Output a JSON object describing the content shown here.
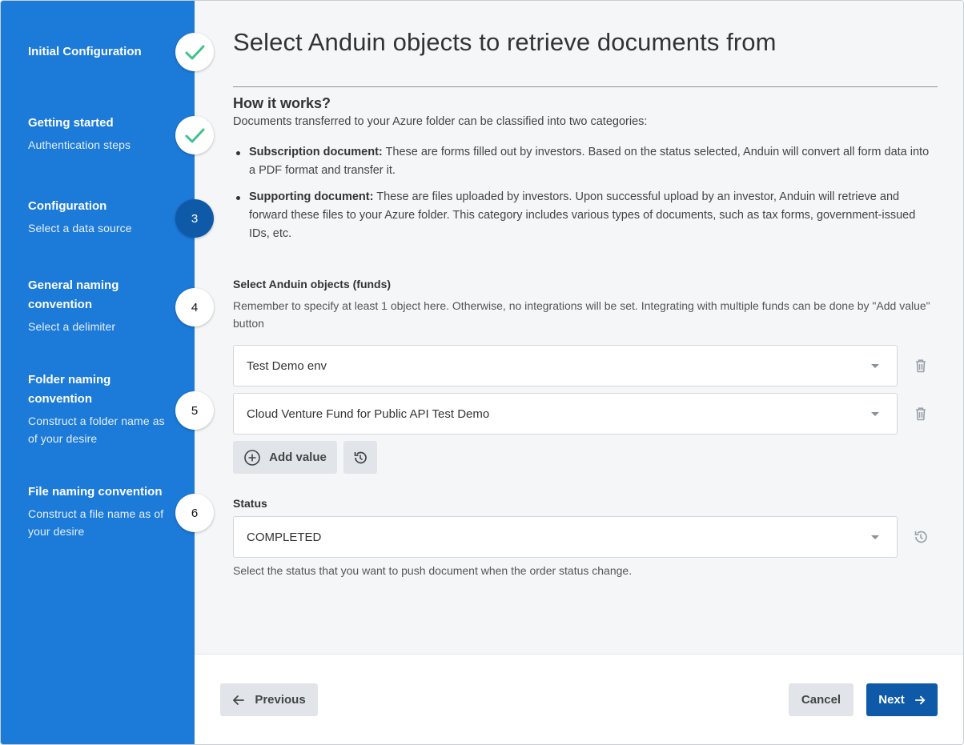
{
  "sidebar": {
    "steps": [
      {
        "title": "Initial Configuration",
        "subtitle": "",
        "marker": "check"
      },
      {
        "title": "Getting started",
        "subtitle": "Authentication steps",
        "marker": "check"
      },
      {
        "title": "Configuration",
        "subtitle": "Select a data source",
        "marker": "3"
      },
      {
        "title": "General naming convention",
        "subtitle": "Select a delimiter",
        "marker": "4"
      },
      {
        "title": "Folder naming convention",
        "subtitle": "Construct a folder name as of your desire",
        "marker": "5"
      },
      {
        "title": "File naming convention",
        "subtitle": "Construct a file name as of your desire",
        "marker": "6"
      }
    ]
  },
  "main": {
    "title": "Select Anduin objects to retrieve documents from",
    "how": {
      "title": "How it works?",
      "intro": "Documents transferred to your Azure folder can be classified into two categories:",
      "bullets": [
        {
          "term": "Subscription document:",
          "text": " These are forms filled out by investors. Based on the status selected, Anduin will convert all form data into a PDF format and transfer it."
        },
        {
          "term": "Supporting document:",
          "text": " These are files uploaded by investors. Upon successful upload by an investor, Anduin will retrieve and forward these files to your Azure folder. This category includes various types of documents, such as tax forms, government-issued IDs, etc."
        }
      ]
    },
    "objects": {
      "label": "Select Anduin objects (funds)",
      "helper": "Remember to specify at least 1 object here. Otherwise, no integrations will be set. Integrating with multiple funds can be done by \"Add value\" button",
      "values": [
        "Test Demo env",
        "Cloud Venture Fund for Public API Test Demo"
      ],
      "add_label": "Add value"
    },
    "status": {
      "label": "Status",
      "value": "COMPLETED",
      "helper": "Select the status that you want to push document when the order status change."
    }
  },
  "footer": {
    "previous_label": "Previous",
    "cancel_label": "Cancel",
    "next_label": "Next"
  },
  "colors": {
    "sidebar": "#1c7ad9",
    "primary": "#0f5aa8",
    "check": "#3ec28f"
  }
}
